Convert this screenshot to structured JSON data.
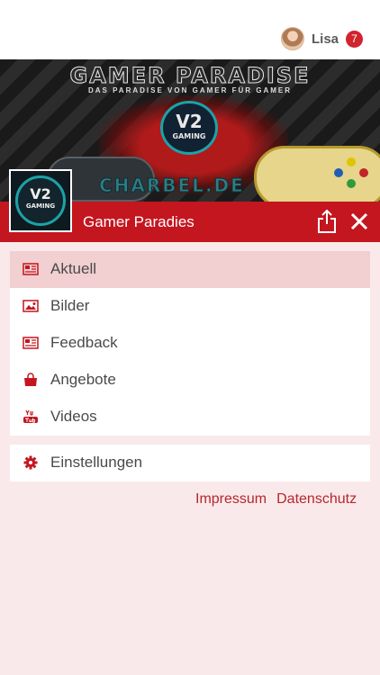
{
  "user": {
    "name": "Lisa",
    "notifications": "7"
  },
  "banner": {
    "title": "GAMER PARADISE",
    "subtitle": "DAS PARADISE VON GAMER FÜR GAMER",
    "logo_big": "V2",
    "logo_small": "GAMING",
    "website": "CHARBEL.DE"
  },
  "header": {
    "site_title": "Gamer Paradies"
  },
  "menu": {
    "items": [
      {
        "label": "Aktuell",
        "icon": "newspaper-icon",
        "active": true
      },
      {
        "label": "Bilder",
        "icon": "image-icon",
        "active": false
      },
      {
        "label": "Feedback",
        "icon": "newspaper-icon",
        "active": false
      },
      {
        "label": "Angebote",
        "icon": "shopping-bag-icon",
        "active": false
      },
      {
        "label": "Videos",
        "icon": "youtube-icon",
        "active": false
      }
    ],
    "settings": {
      "label": "Einstellungen",
      "icon": "gear-icon"
    }
  },
  "footer": {
    "impressum": "Impressum",
    "datenschutz": "Datenschutz"
  },
  "colors": {
    "accent": "#c4161f",
    "background": "#fae9ea",
    "active_item": "#f2cfd1"
  }
}
